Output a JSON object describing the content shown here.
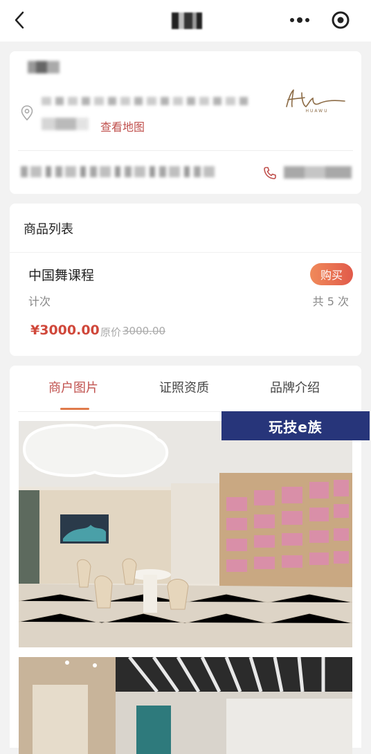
{
  "topbar": {
    "back_icon": "chevron-left-icon",
    "more_icon": "more-dots-icon",
    "target_icon": "target-icon"
  },
  "merchant": {
    "map_link": "查看地图",
    "location_icon": "location-pin-icon",
    "phone_icon": "phone-icon",
    "logo_text": "HUAWU"
  },
  "goods": {
    "section_title": "商品列表",
    "items": [
      {
        "name": "中国舞课程",
        "unit": "计次",
        "count": "共 5 次",
        "price": "¥3000.00",
        "original_label": "原价",
        "original_price": "3000.00",
        "buy_label": "购买"
      }
    ]
  },
  "tabs": [
    {
      "label": "商户图片",
      "active": true
    },
    {
      "label": "证照资质",
      "active": false
    },
    {
      "label": "品牌介绍",
      "active": false
    }
  ],
  "watermark": "玩技e族",
  "colors": {
    "accent": "#c0504d",
    "buy_button": "#e86a4f",
    "watermark_bg": "#27357a"
  }
}
